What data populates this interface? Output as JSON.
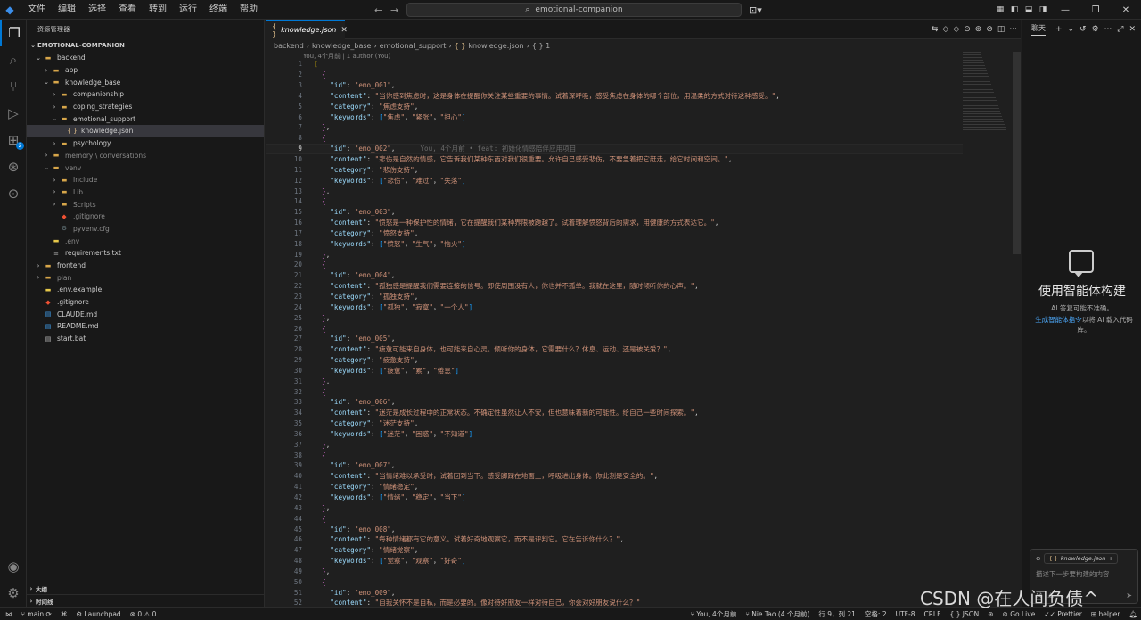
{
  "titlebar": {
    "menu": [
      "文件",
      "编辑",
      "选择",
      "查看",
      "转到",
      "运行",
      "终端",
      "帮助"
    ],
    "search": "emotional-companion"
  },
  "sidebar": {
    "header": "资源管理器",
    "root": "EMOTIONAL-COMPANION",
    "items": [
      {
        "label": "backend",
        "depth": 0,
        "type": "folder-open"
      },
      {
        "label": "app",
        "depth": 1,
        "type": "folder"
      },
      {
        "label": "knowledge_base",
        "depth": 1,
        "type": "folder-open"
      },
      {
        "label": "companionship",
        "depth": 2,
        "type": "folder"
      },
      {
        "label": "coping_strategies",
        "depth": 2,
        "type": "folder"
      },
      {
        "label": "emotional_support",
        "depth": 2,
        "type": "folder-open"
      },
      {
        "label": "knowledge.json",
        "depth": 3,
        "type": "json",
        "selected": true
      },
      {
        "label": "psychology",
        "depth": 2,
        "type": "folder"
      },
      {
        "label": "memory \\ conversations",
        "depth": 1,
        "type": "folder",
        "dim": true
      },
      {
        "label": "venv",
        "depth": 1,
        "type": "folder-open",
        "dim": true
      },
      {
        "label": "Include",
        "depth": 2,
        "type": "folder",
        "dim": true
      },
      {
        "label": "Lib",
        "depth": 2,
        "type": "folder",
        "dim": true
      },
      {
        "label": "Scripts",
        "depth": 2,
        "type": "folder",
        "dim": true
      },
      {
        "label": ".gitignore",
        "depth": 2,
        "type": "git",
        "dim": true
      },
      {
        "label": "pyvenv.cfg",
        "depth": 2,
        "type": "gear",
        "dim": true
      },
      {
        "label": ".env",
        "depth": 1,
        "type": "env",
        "dim": true
      },
      {
        "label": "requirements.txt",
        "depth": 1,
        "type": "txt"
      },
      {
        "label": "frontend",
        "depth": 0,
        "type": "folder"
      },
      {
        "label": "plan",
        "depth": 0,
        "type": "folder",
        "dim": true
      },
      {
        "label": ".env.example",
        "depth": 0,
        "type": "env"
      },
      {
        "label": ".gitignore",
        "depth": 0,
        "type": "git"
      },
      {
        "label": "CLAUDE.md",
        "depth": 0,
        "type": "md"
      },
      {
        "label": "README.md",
        "depth": 0,
        "type": "md"
      },
      {
        "label": "start.bat",
        "depth": 0,
        "type": "bat"
      }
    ],
    "bottom": [
      "大纲",
      "时间线"
    ]
  },
  "editor": {
    "tab": "knowledge.json",
    "breadcrumb": [
      "backend",
      "knowledge_base",
      "emotional_support",
      "knowledge.json",
      "{ } 1"
    ],
    "blame_header": "You, 4个月前 | 1 author (You)",
    "ghost_blame": "You, 4个月前 • feat: 初始化情感陪伴应用项目",
    "entries": [
      {
        "id": "emo_001",
        "content": "当你感到焦虑时，这是身体在提醒你关注某些重要的事情。试着深呼吸，感受焦虑在身体的哪个部位，用温柔的方式对待这种感受。",
        "category": "焦虑支持",
        "keywords": [
          "焦虑",
          "紧张",
          "担心"
        ]
      },
      {
        "id": "emo_002",
        "content": "悲伤是自然的情感，它告诉我们某种东西对我们很重要。允许自己感受悲伤，不要急着把它赶走，给它时间和空间。",
        "category": "悲伤支持",
        "keywords": [
          "悲伤",
          "难过",
          "失落"
        ]
      },
      {
        "id": "emo_003",
        "content": "愤怒是一种保护性的情绪，它在提醒我们某种界限被跨越了。试着理解愤怒背后的需求，用健康的方式表达它。",
        "category": "愤怒支持",
        "keywords": [
          "愤怒",
          "生气",
          "恼火"
        ]
      },
      {
        "id": "emo_004",
        "content": "孤独感是提醒我们需要连接的信号。即使周围没有人，你也并不孤单。我就在这里，随时倾听你的心声。",
        "category": "孤独支持",
        "keywords": [
          "孤独",
          "寂寞",
          "一个人"
        ]
      },
      {
        "id": "emo_005",
        "content": "疲惫可能来自身体，也可能来自心灵。倾听你的身体，它需要什么？休息、运动、还是被关爱？",
        "category": "疲惫支持",
        "keywords": [
          "疲惫",
          "累",
          "倦怠"
        ]
      },
      {
        "id": "emo_006",
        "content": "迷茫是成长过程中的正常状态。不确定性虽然让人不安，但也意味着新的可能性。给自己一些时间探索。",
        "category": "迷茫支持",
        "keywords": [
          "迷茫",
          "困惑",
          "不知道"
        ]
      },
      {
        "id": "emo_007",
        "content": "当情绪难以承受时，试着回到当下。感受脚踩在地面上，呼吸进出身体。你此刻是安全的。",
        "category": "情绪稳定",
        "keywords": [
          "情绪",
          "稳定",
          "当下"
        ]
      },
      {
        "id": "emo_008",
        "content": "每种情绪都有它的意义。试着好奇地观察它，而不是评判它。它在告诉你什么？",
        "category": "情绪觉察",
        "keywords": [
          "觉察",
          "观察",
          "好奇"
        ]
      },
      {
        "id": "emo_009",
        "content": "自我关怀不是自私，而是必要的。像对待好朋友一样对待自己，你会对好朋友说什么？"
      }
    ]
  },
  "chat": {
    "tab": "聊天",
    "title": "使用智能体构建",
    "subtitle": "AI 答复可能不准确。",
    "desc_link": "生成智能体指令",
    "desc_rest": "以将 AI 载入代码库。",
    "file_chip": "knowledge.json",
    "placeholder": "描述下一步要构建的内容"
  },
  "statusbar": {
    "branch": "main",
    "launchpad": "Launchpad",
    "problems": "⊗ 0 ⚠ 0",
    "blame": "You, 4个月前",
    "author": "Nie Tao (4 个月前)",
    "position": "行 9，列 21",
    "spaces": "空格: 2",
    "encoding": "UTF-8",
    "eol": "CRLF",
    "language": "{ } JSON",
    "golive": "Go Live",
    "prettier": "Prettier",
    "helper": "helper"
  },
  "watermark": "CSDN @在人间负债^"
}
